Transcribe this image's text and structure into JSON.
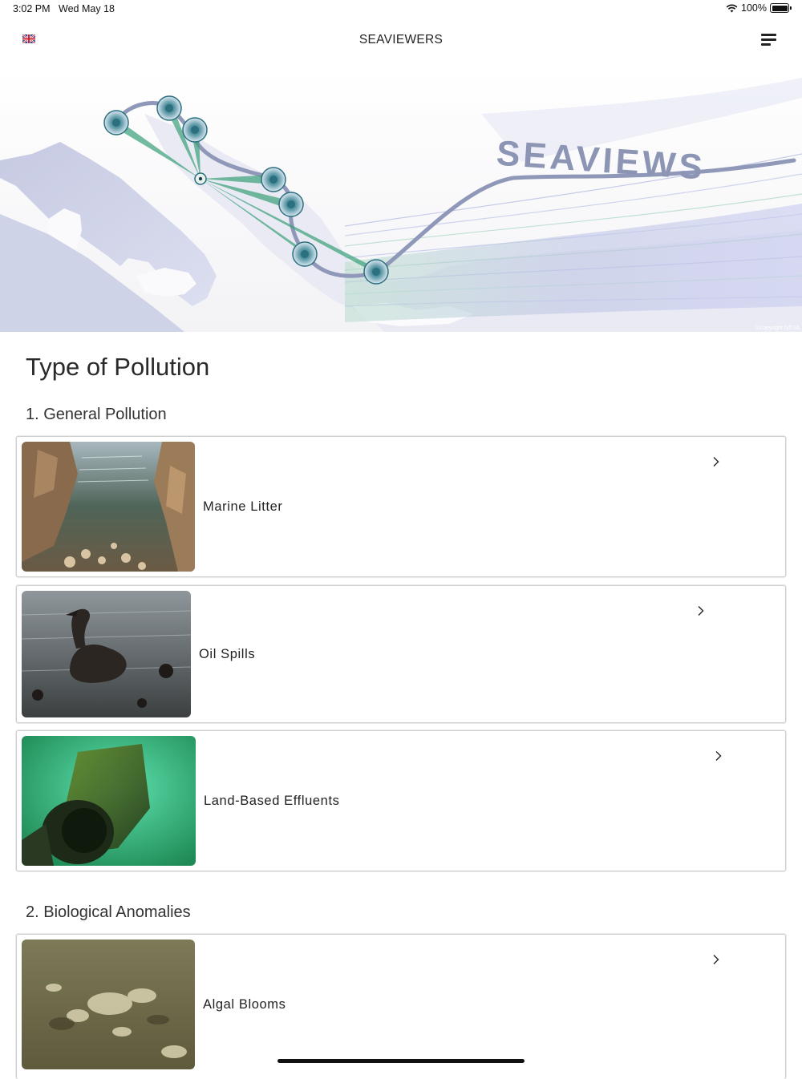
{
  "status": {
    "time": "3:02 PM",
    "date": "Wed May 18",
    "battery": "100%"
  },
  "nav": {
    "title": "SEAVIEWERS",
    "language_icon": "uk-flag-icon",
    "menu_icon": "menu-icon"
  },
  "hero": {
    "logo_text": "SEAVIEWS",
    "copyright": "©copyright NTUA"
  },
  "page_title": "Type of Pollution",
  "sections": [
    {
      "title": "1. General Pollution",
      "items": [
        {
          "label": "Marine Litter"
        },
        {
          "label": "Oil Spills"
        },
        {
          "label": "Land-Based Effluents"
        }
      ]
    },
    {
      "title": "2. Biological Anomalies",
      "items": [
        {
          "label": "Algal Blooms"
        }
      ]
    }
  ],
  "colors": {
    "accent": "#2c6f7e",
    "route": "#8f98b8",
    "teal_beam": "#3aa07a"
  }
}
